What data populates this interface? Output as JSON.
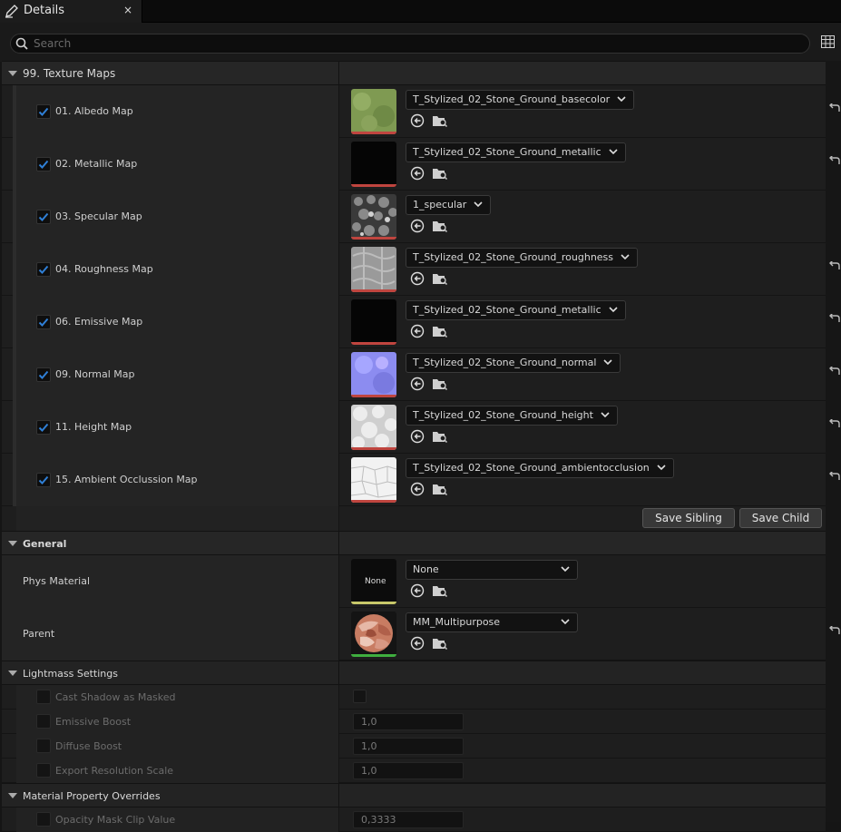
{
  "tab": {
    "title": "Details",
    "close": "×"
  },
  "search": {
    "placeholder": "Search"
  },
  "sections": {
    "texture_maps": "99. Texture Maps",
    "general": "General",
    "lightmass": "Lightmass Settings",
    "overrides": "Material Property Overrides"
  },
  "texture_rows": [
    {
      "label": "01. Albedo Map",
      "asset": "T_Stylized_02_Stone_Ground_basecolor",
      "checked": true
    },
    {
      "label": "02. Metallic Map",
      "asset": "T_Stylized_02_Stone_Ground_metallic",
      "checked": true
    },
    {
      "label": "03. Specular Map",
      "asset": "1_specular",
      "checked": true
    },
    {
      "label": "04. Roughness Map",
      "asset": "T_Stylized_02_Stone_Ground_roughness",
      "checked": true
    },
    {
      "label": "06. Emissive Map",
      "asset": "T_Stylized_02_Stone_Ground_metallic",
      "checked": true
    },
    {
      "label": "09. Normal Map",
      "asset": "T_Stylized_02_Stone_Ground_normal",
      "checked": true
    },
    {
      "label": "11. Height Map",
      "asset": "T_Stylized_02_Stone_Ground_height",
      "checked": true
    },
    {
      "label": "15. Ambient Occlussion Map",
      "asset": "T_Stylized_02_Stone_Ground_ambientocclusion",
      "checked": true
    }
  ],
  "buttons": {
    "save_sibling": "Save Sibling",
    "save_child": "Save Child"
  },
  "general": {
    "phys_label": "Phys Material",
    "phys_thumb_text": "None",
    "phys_value": "None",
    "parent_label": "Parent",
    "parent_value": "MM_Multipurpose"
  },
  "lightmass": {
    "cast_shadow": "Cast Shadow as Masked",
    "emissive_boost": "Emissive Boost",
    "emissive_boost_value": "1,0",
    "diffuse_boost": "Diffuse Boost",
    "diffuse_boost_value": "1,0",
    "export_res": "Export Resolution Scale",
    "export_res_value": "1,0"
  },
  "overrides": {
    "opacity_clip": "Opacity Mask Clip Value",
    "opacity_clip_value": "0,3333"
  },
  "colors": {
    "accent": "#2f7fd6",
    "link_bar": "#c0453f",
    "parent_bar": "#3fae3f"
  }
}
